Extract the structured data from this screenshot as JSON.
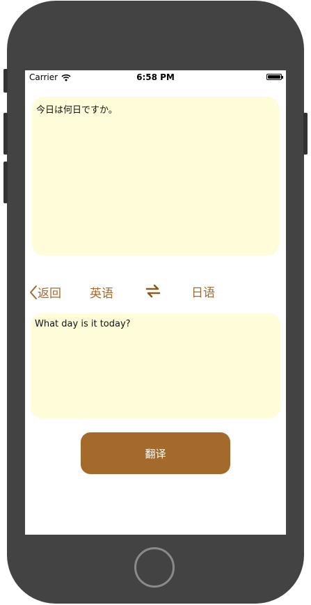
{
  "status_bar": {
    "carrier": "Carrier",
    "time": "6:58 PM"
  },
  "source": {
    "text": "今日は何日ですか。"
  },
  "language_bar": {
    "back_label": "返回",
    "from_language": "英语",
    "to_language": "日语",
    "swap_icon": "swap-arrows-icon"
  },
  "target": {
    "text": "What day is it today?"
  },
  "actions": {
    "translate_label": "翻译"
  },
  "colors": {
    "accent": "#a46a2c",
    "text_box_bg": "#fffcd9",
    "phone_frame": "#434343"
  }
}
